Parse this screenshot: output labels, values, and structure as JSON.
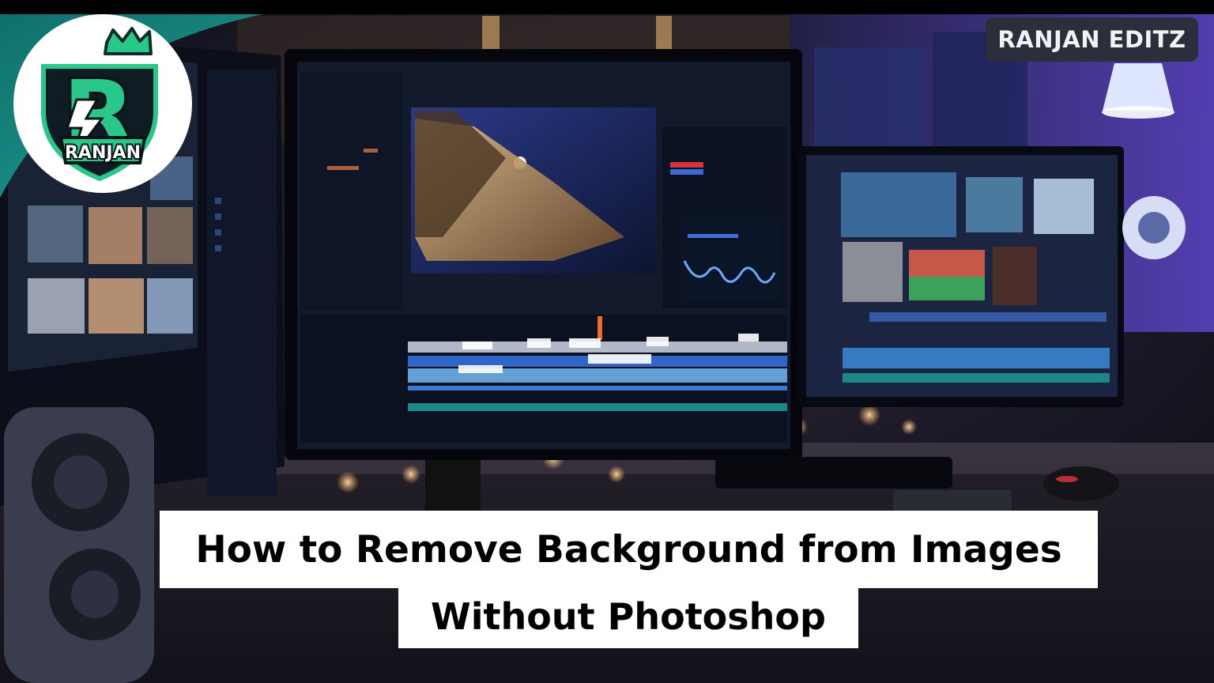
{
  "watermark": {
    "text": "RANJAN EDITZ"
  },
  "logo": {
    "text": "RANJAN",
    "letter": "R",
    "icon": "crown-shield-lightning-icon"
  },
  "headline": {
    "line1": "How to Remove Background from Images",
    "line2": "Without Photoshop"
  },
  "colors": {
    "accent_teal": "#1a8f86",
    "logo_green": "#29c78a",
    "title_bg": "#ffffff",
    "title_text": "#000000"
  },
  "scene": {
    "description_icon": "video-editing-desk-monitors-icon"
  }
}
